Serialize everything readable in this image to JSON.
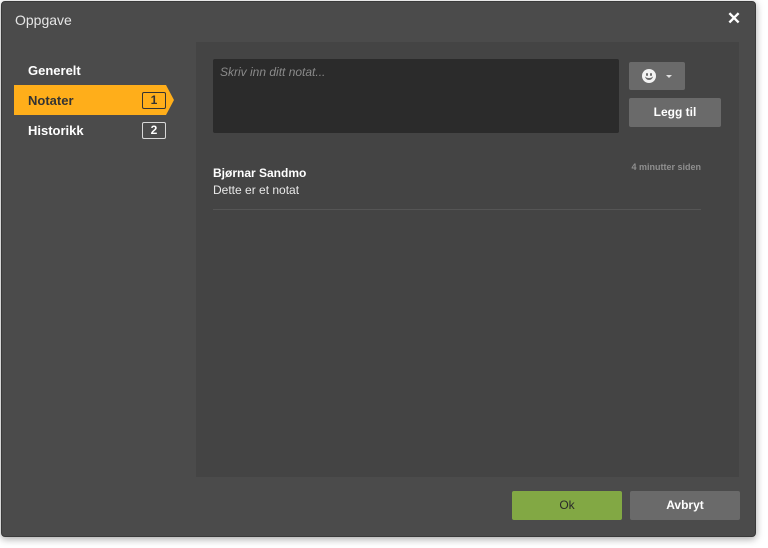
{
  "dialog": {
    "title": "Oppgave",
    "close_icon": "close-icon",
    "close_glyph": "✕"
  },
  "sidebar": {
    "items": [
      {
        "label": "Generelt",
        "count": null,
        "active": false
      },
      {
        "label": "Notater",
        "count": "1",
        "active": true
      },
      {
        "label": "Historikk",
        "count": "2",
        "active": false
      }
    ]
  },
  "notes": {
    "input": {
      "placeholder": "Skriv inn ditt notat...",
      "value": ""
    },
    "emoji_icon": "smiley-icon",
    "add_label": "Legg til",
    "list": [
      {
        "author": "Bjørnar Sandmo",
        "text": "Dette er et notat",
        "time": "4 minutter siden"
      }
    ]
  },
  "footer": {
    "ok_label": "Ok",
    "cancel_label": "Avbryt"
  },
  "colors": {
    "accent": "#ffae1a",
    "ok": "#82a844",
    "dialog_bg": "#4b4b4b",
    "panel_bg": "#444444",
    "input_bg": "#2b2b2b",
    "button_bg": "#6a6a6a"
  }
}
